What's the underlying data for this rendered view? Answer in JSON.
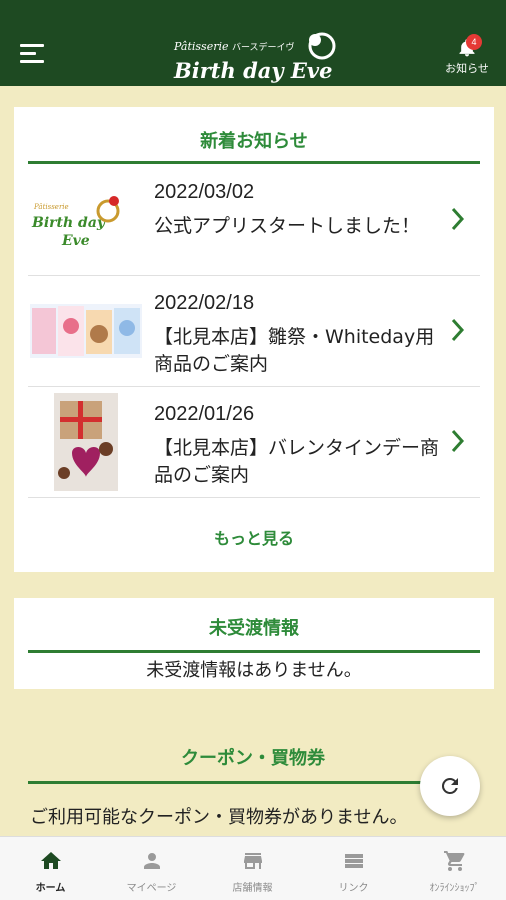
{
  "header": {
    "logo_script": "Pâtisserie",
    "logo_kana": "バースデーイヴ",
    "logo_main": "Birth day Eve",
    "notice_label": "お知らせ",
    "notice_count": "4"
  },
  "news": {
    "title": "新着お知らせ",
    "items": [
      {
        "date": "2022/03/02",
        "title": "公式アプリスタートしました！",
        "thumb_text_1": "Pâtisserie",
        "thumb_text_2": "Birth day",
        "thumb_text_3": "Eve"
      },
      {
        "date": "2022/02/18",
        "title": "【北見本店】雛祭・Whiteday用商品のご案内"
      },
      {
        "date": "2022/01/26",
        "title": "【北見本店】バレンタインデー商品のご案内"
      }
    ],
    "more_label": "もっと見る"
  },
  "undelivered": {
    "title": "未受渡情報",
    "message": "未受渡情報はありません。"
  },
  "coupon": {
    "title": "クーポン・買物券",
    "message": "ご利用可能なクーポン・買物券がありません。"
  },
  "tabs": [
    {
      "label": "ホーム",
      "icon": "home-icon",
      "active": true
    },
    {
      "label": "マイページ",
      "icon": "person-icon",
      "active": false
    },
    {
      "label": "店舗情報",
      "icon": "store-icon",
      "active": false
    },
    {
      "label": "リンク",
      "icon": "list-icon",
      "active": false
    },
    {
      "label": "ｵﾝﾗｲﾝｼｮｯﾌﾟ",
      "icon": "cart-icon",
      "active": false
    }
  ],
  "colors": {
    "header_bg": "#1e4a22",
    "page_bg": "#f2ebc2",
    "accent_green": "#2e8b3a",
    "badge_red": "#e53935"
  }
}
